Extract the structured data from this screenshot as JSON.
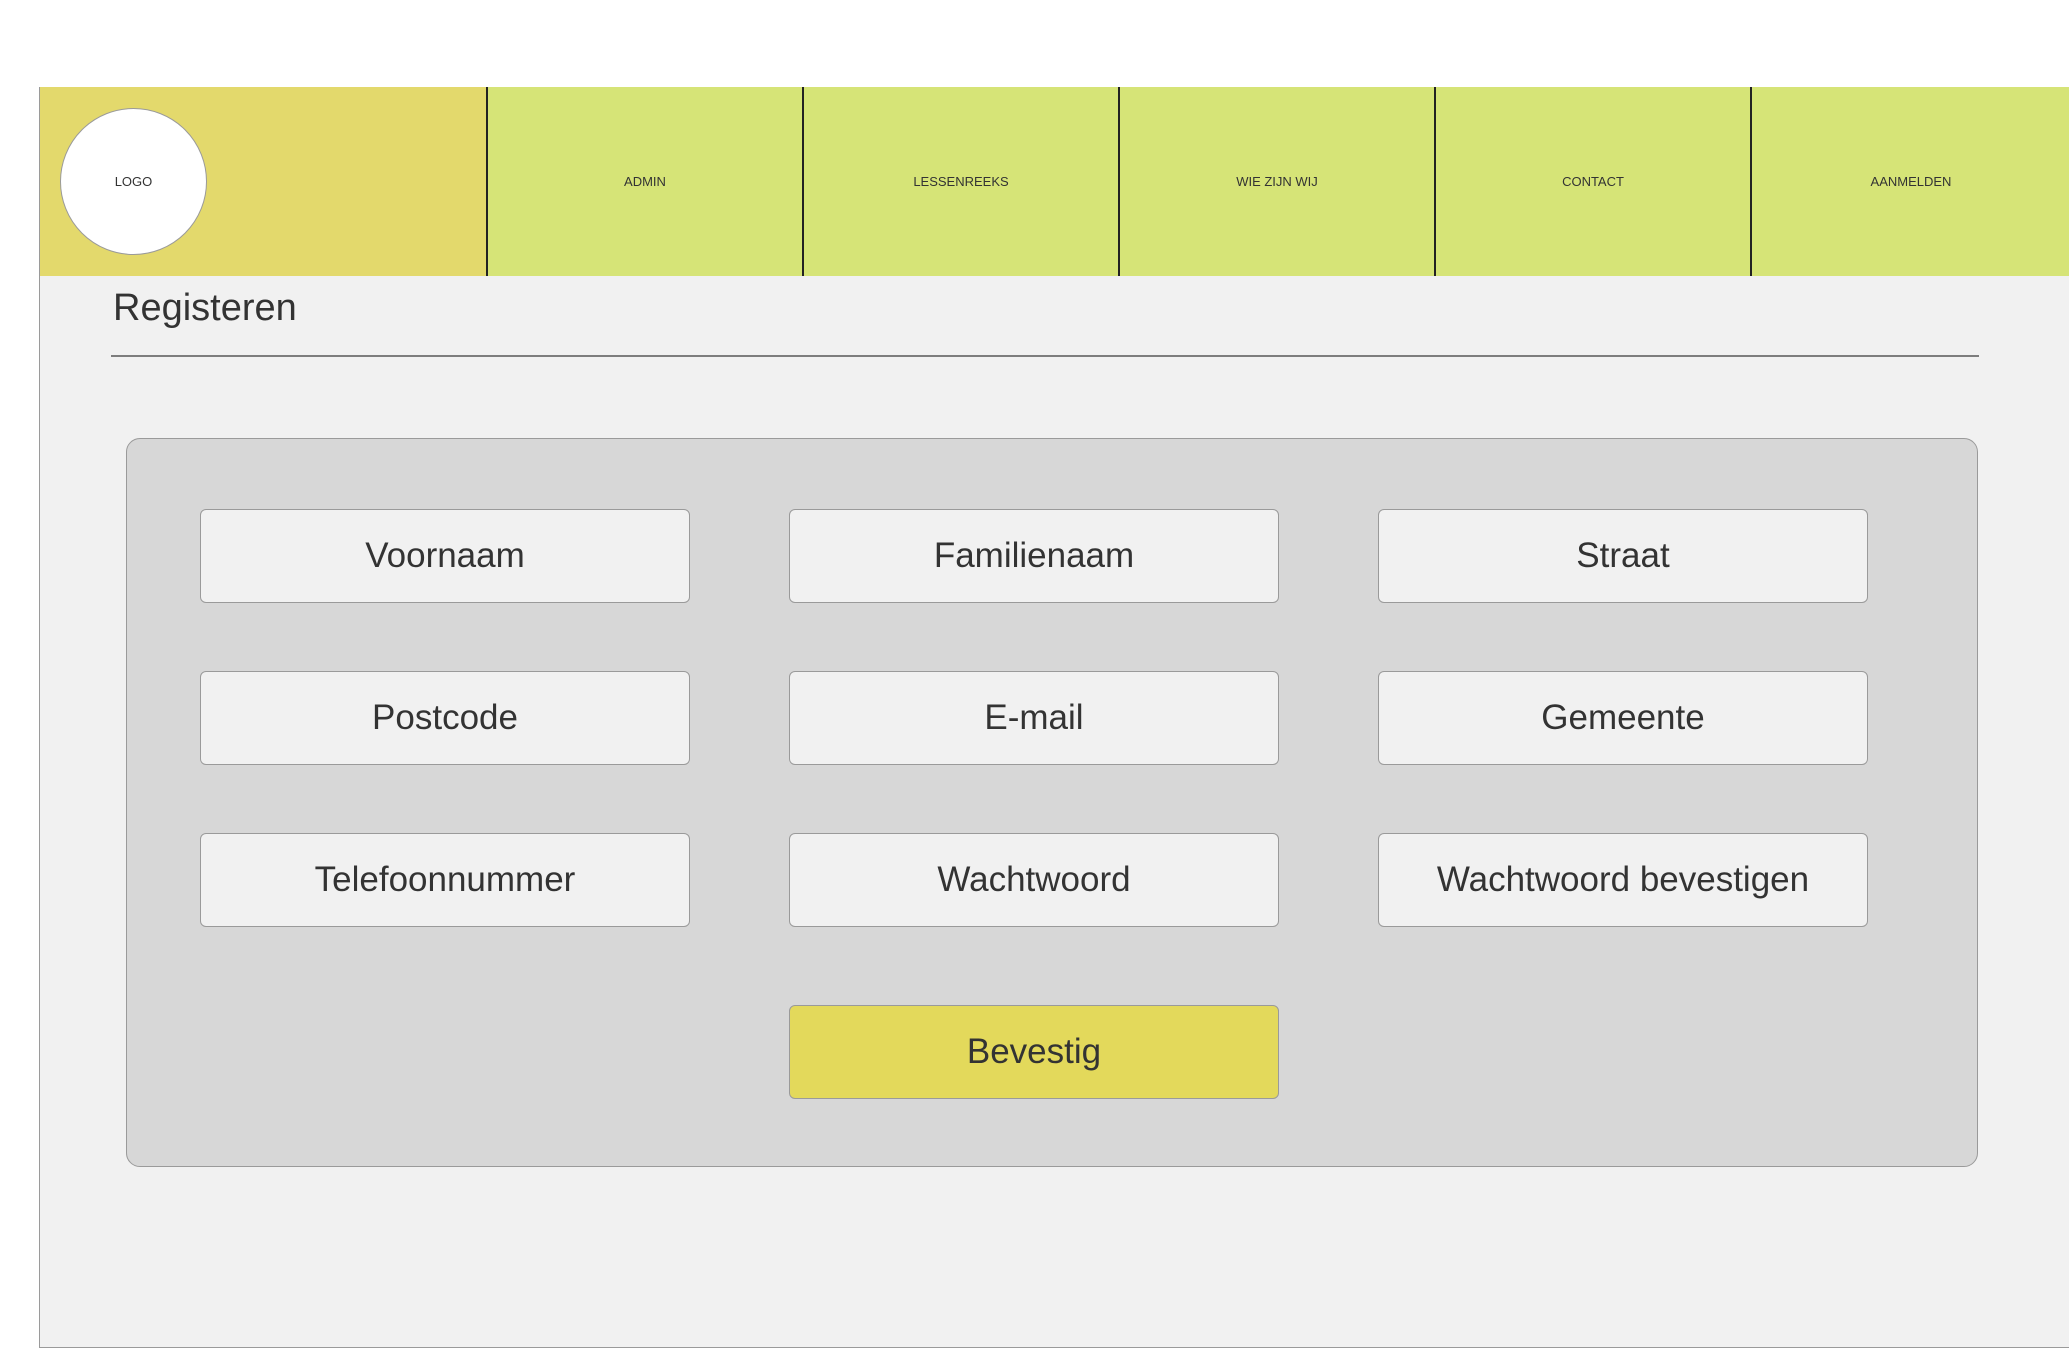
{
  "header": {
    "logo_text": "LOGO",
    "nav": [
      {
        "label": "ADMIN"
      },
      {
        "label": "LESSENREEKS"
      },
      {
        "label": "WIE ZIJN WIJ"
      },
      {
        "label": "CONTACT"
      },
      {
        "label": "AANMELDEN"
      }
    ]
  },
  "page": {
    "title": "Registeren"
  },
  "form": {
    "fields": {
      "voornaam": "Voornaam",
      "familienaam": "Familienaam",
      "straat": "Straat",
      "postcode": "Postcode",
      "email": "E-mail",
      "gemeente": "Gemeente",
      "telefoonnummer": "Telefoonnummer",
      "wachtwoord": "Wachtwoord",
      "wachtwoord_bevestigen": "Wachtwoord bevestigen"
    },
    "submit_label": "Bevestig"
  },
  "colors": {
    "logo_bg": "#e3d96c",
    "nav_bg": "#d6e477",
    "page_bg": "#f1f1f1",
    "panel_bg": "#d7d7d7",
    "submit_bg": "#e3d95b"
  }
}
